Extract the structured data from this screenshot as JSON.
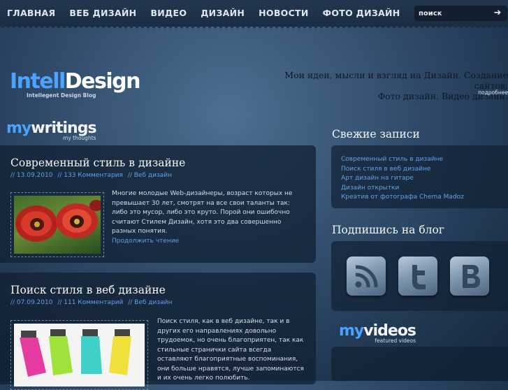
{
  "nav": {
    "items": [
      "ГЛАВНАЯ",
      "ВЕБ ДИЗАЙН",
      "ВИДЕО",
      "ДИЗАЙН",
      "НОВОСТИ",
      "ФОТО ДИЗАЙН"
    ],
    "search_placeholder": "поиск",
    "search_icon": "arrow-right-icon"
  },
  "header": {
    "logo_part1": "Intell",
    "logo_part2": "Design",
    "logo_tagline": "Intellegent Design Blog",
    "tagline_line1": "Мои идеи, мысли и взгляд на Дизайн. Создание сайтов,",
    "tagline_line2": "Фото дизайн, Видео дизайн.",
    "more_link": "подробнее"
  },
  "writings": {
    "prefix": "my",
    "word": "writings",
    "sub": "my thoughts"
  },
  "posts": [
    {
      "title": "Современный стиль в дизайне",
      "date": "// 13.09.2010",
      "comments": "// 133 Комментария",
      "category": "// Веб дизайн",
      "text": "Многие молодые Web-дизайнеры, возраст которых не превышает 30 лет, смотрят на все свои таланты так: либо это мусор, либо это круто. Порой они ошибочно считают Стилем Дизайн, хотя это два совершенно разных понятия.",
      "read_more": "Продолжить чтение"
    },
    {
      "title": "Поиск стиля в веб дизайне",
      "date": "// 07.09.2010",
      "comments": "// 111 Комментарий",
      "category": "// Веб дизайн",
      "text": "Поиск стиля, как в веб дизайне, так и в других его направлениях довольно трудоемок, но очень благоприятен, так как стильные странички сайта всегда оставляют благоприятные воспоминания, они больше нравятся, лучше запоминаются и их очень легко полюбить."
    }
  ],
  "sidebar": {
    "recent_title": "Свежие записи",
    "recent": [
      "Современный стиль в дизайне",
      "Поиск стиля в веб дизайне",
      "Арт дизайн на гитаре",
      "Дизайн открытки",
      "Креатив от фотографа Chema Madoz"
    ],
    "subscribe_title": "Подпишись на блог",
    "social": [
      "rss-icon",
      "twitter-icon",
      "vkontakte-icon"
    ]
  },
  "videos": {
    "prefix": "my",
    "word": "videos",
    "sub": "featured videos"
  },
  "colors": {
    "accent": "#4aa3ff",
    "link": "#5ea2e6",
    "panel": "#122133"
  }
}
